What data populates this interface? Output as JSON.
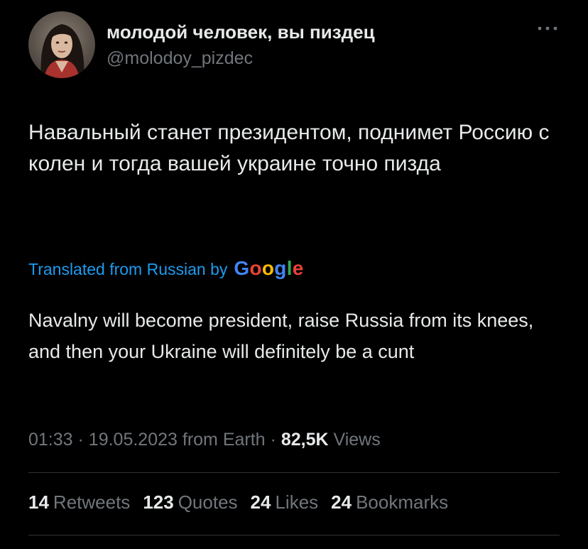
{
  "author": {
    "name": "молодой человек, вы пиздец",
    "handle": "@molodoy_pizdec"
  },
  "tweet": {
    "text": "Навальный станет президентом, поднимет Россию с колен и тогда вашей украине точно пизда",
    "translated_label": "Translated from Russian by",
    "translated_text": "Navalny will become president, raise Russia from its knees, and then your Ukraine will definitely be a cunt"
  },
  "google_logo": {
    "letters": [
      "G",
      "o",
      "o",
      "g",
      "l",
      "e"
    ],
    "colors": [
      "#4285f4",
      "#ea4335",
      "#fbbc05",
      "#4285f4",
      "#34a853",
      "#ea4335"
    ]
  },
  "meta": {
    "time": "01:33",
    "date": "19.05.2023",
    "source": "from Earth",
    "views_count": "82,5K",
    "views_label": "Views",
    "separator": "·"
  },
  "stats": {
    "retweets": {
      "count": "14",
      "label": "Retweets"
    },
    "quotes": {
      "count": "123",
      "label": "Quotes"
    },
    "likes": {
      "count": "24",
      "label": "Likes"
    },
    "bookmarks": {
      "count": "24",
      "label": "Bookmarks"
    }
  },
  "icons": {
    "more": "more-horizontal-icon"
  },
  "colors": {
    "background": "#000000",
    "text_primary": "#e7e9ea",
    "text_secondary": "#71767b",
    "link_blue": "#1d9bf0",
    "divider": "#2f3336"
  }
}
